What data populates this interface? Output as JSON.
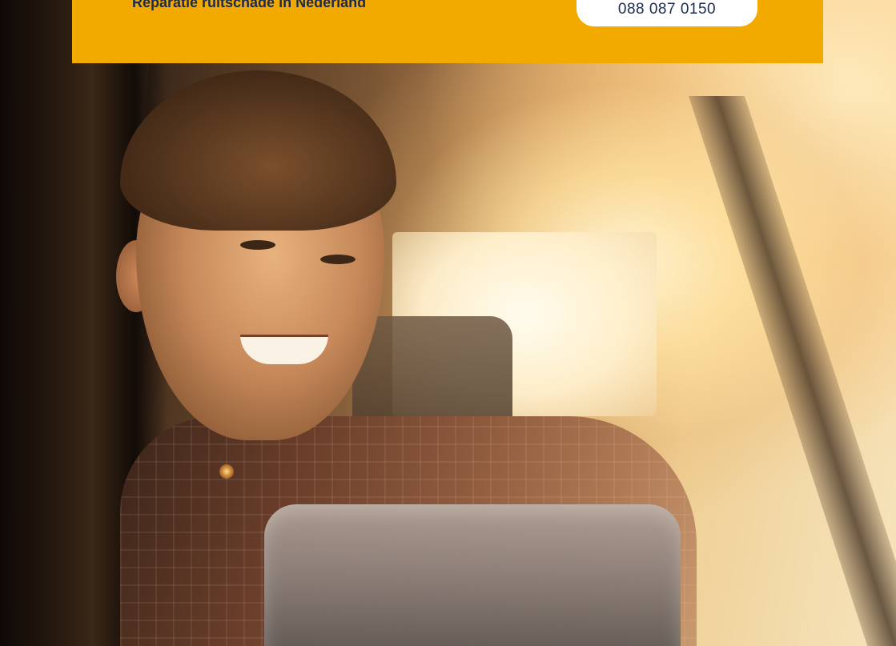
{
  "header": {
    "title": "Reparatie ruitschade in Nederland",
    "phone_label": "088 087 0150"
  },
  "hero": {
    "image_subject": "man-smiling-in-car"
  },
  "colors": {
    "brand_yellow": "#f2a900",
    "text_navy": "#1b2a4e",
    "button_white": "#ffffff"
  }
}
